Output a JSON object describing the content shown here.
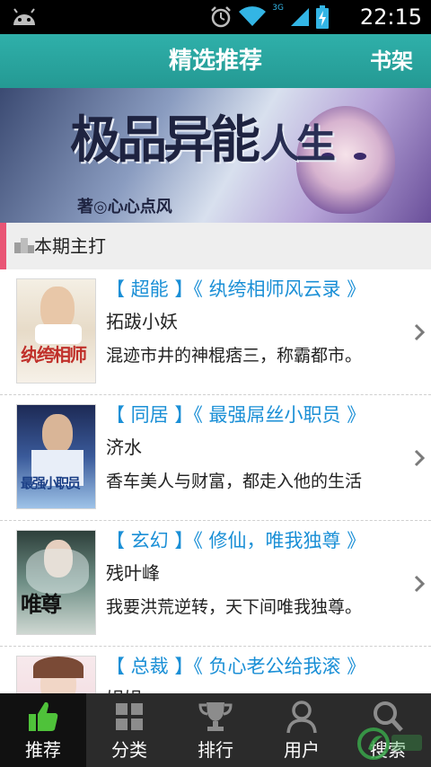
{
  "status_bar": {
    "time": "22:15",
    "network": "3G",
    "icons": [
      "android-icon",
      "alarm-icon",
      "wifi-icon",
      "signal-icon",
      "battery-icon"
    ]
  },
  "header": {
    "title": "精选推荐",
    "shelf_label": "书架"
  },
  "banner": {
    "title": "极品异能",
    "title_char": "人生",
    "author": "著◎心心点风"
  },
  "section": {
    "label": "本期主打"
  },
  "books": [
    {
      "title": "【 超能 】《 纨绔相师风云录 》",
      "author": "拓跋小妖",
      "desc": "混迹市井的神棍痞三，称霸都市。",
      "cover_text": "纨绔相师"
    },
    {
      "title": "【 同居 】《 最强屌丝小职员 》",
      "author": "济水",
      "desc": "香车美人与财富，都走入他的生活",
      "cover_text": "最强小职员"
    },
    {
      "title": "【 玄幻 】《 修仙，唯我独尊 》",
      "author": "残叶峰",
      "desc": "我要洪荒逆转，天下间唯我独尊。",
      "cover_text": "唯尊"
    },
    {
      "title": "【 总裁 】《 负心老公给我滚 》",
      "author": "娟娟",
      "desc": "",
      "cover_text": ""
    }
  ],
  "bottom_nav": [
    {
      "label": "推荐",
      "icon": "thumbs-up-icon",
      "active": true
    },
    {
      "label": "分类",
      "icon": "grid-icon",
      "active": false
    },
    {
      "label": "排行",
      "icon": "trophy-icon",
      "active": false
    },
    {
      "label": "用户",
      "icon": "user-icon",
      "active": false
    },
    {
      "label": "搜索",
      "icon": "search-icon",
      "active": false
    }
  ],
  "colors": {
    "header": "#2aa6a0",
    "accent_link": "#1a8fd6",
    "section_bar": "#e95575",
    "nav_bg": "#2b2b2b",
    "nav_active_icon": "#4fc23a"
  }
}
